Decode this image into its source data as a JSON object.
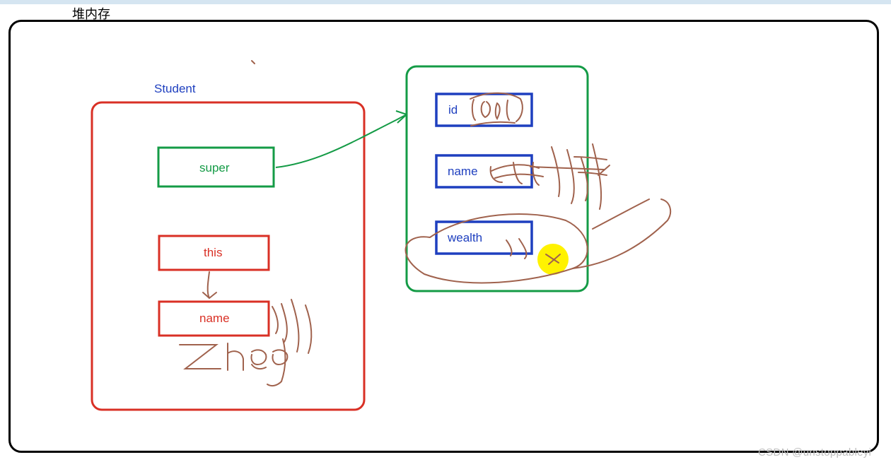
{
  "header": {
    "heap_label": "堆内存"
  },
  "left_box": {
    "title": "Student",
    "super_label": "super",
    "this_label": "this",
    "name_label": "name"
  },
  "right_box": {
    "id_label": "id",
    "name_label": "name",
    "wealth_label": "wealth"
  },
  "watermark": "CSDN @unstoppableyi",
  "colors": {
    "frame_black": "#000000",
    "red": "#d93025",
    "green": "#149b46",
    "blue": "#1e3fbf",
    "brown": "#a0624d",
    "highlight_yellow": "#fff200"
  }
}
